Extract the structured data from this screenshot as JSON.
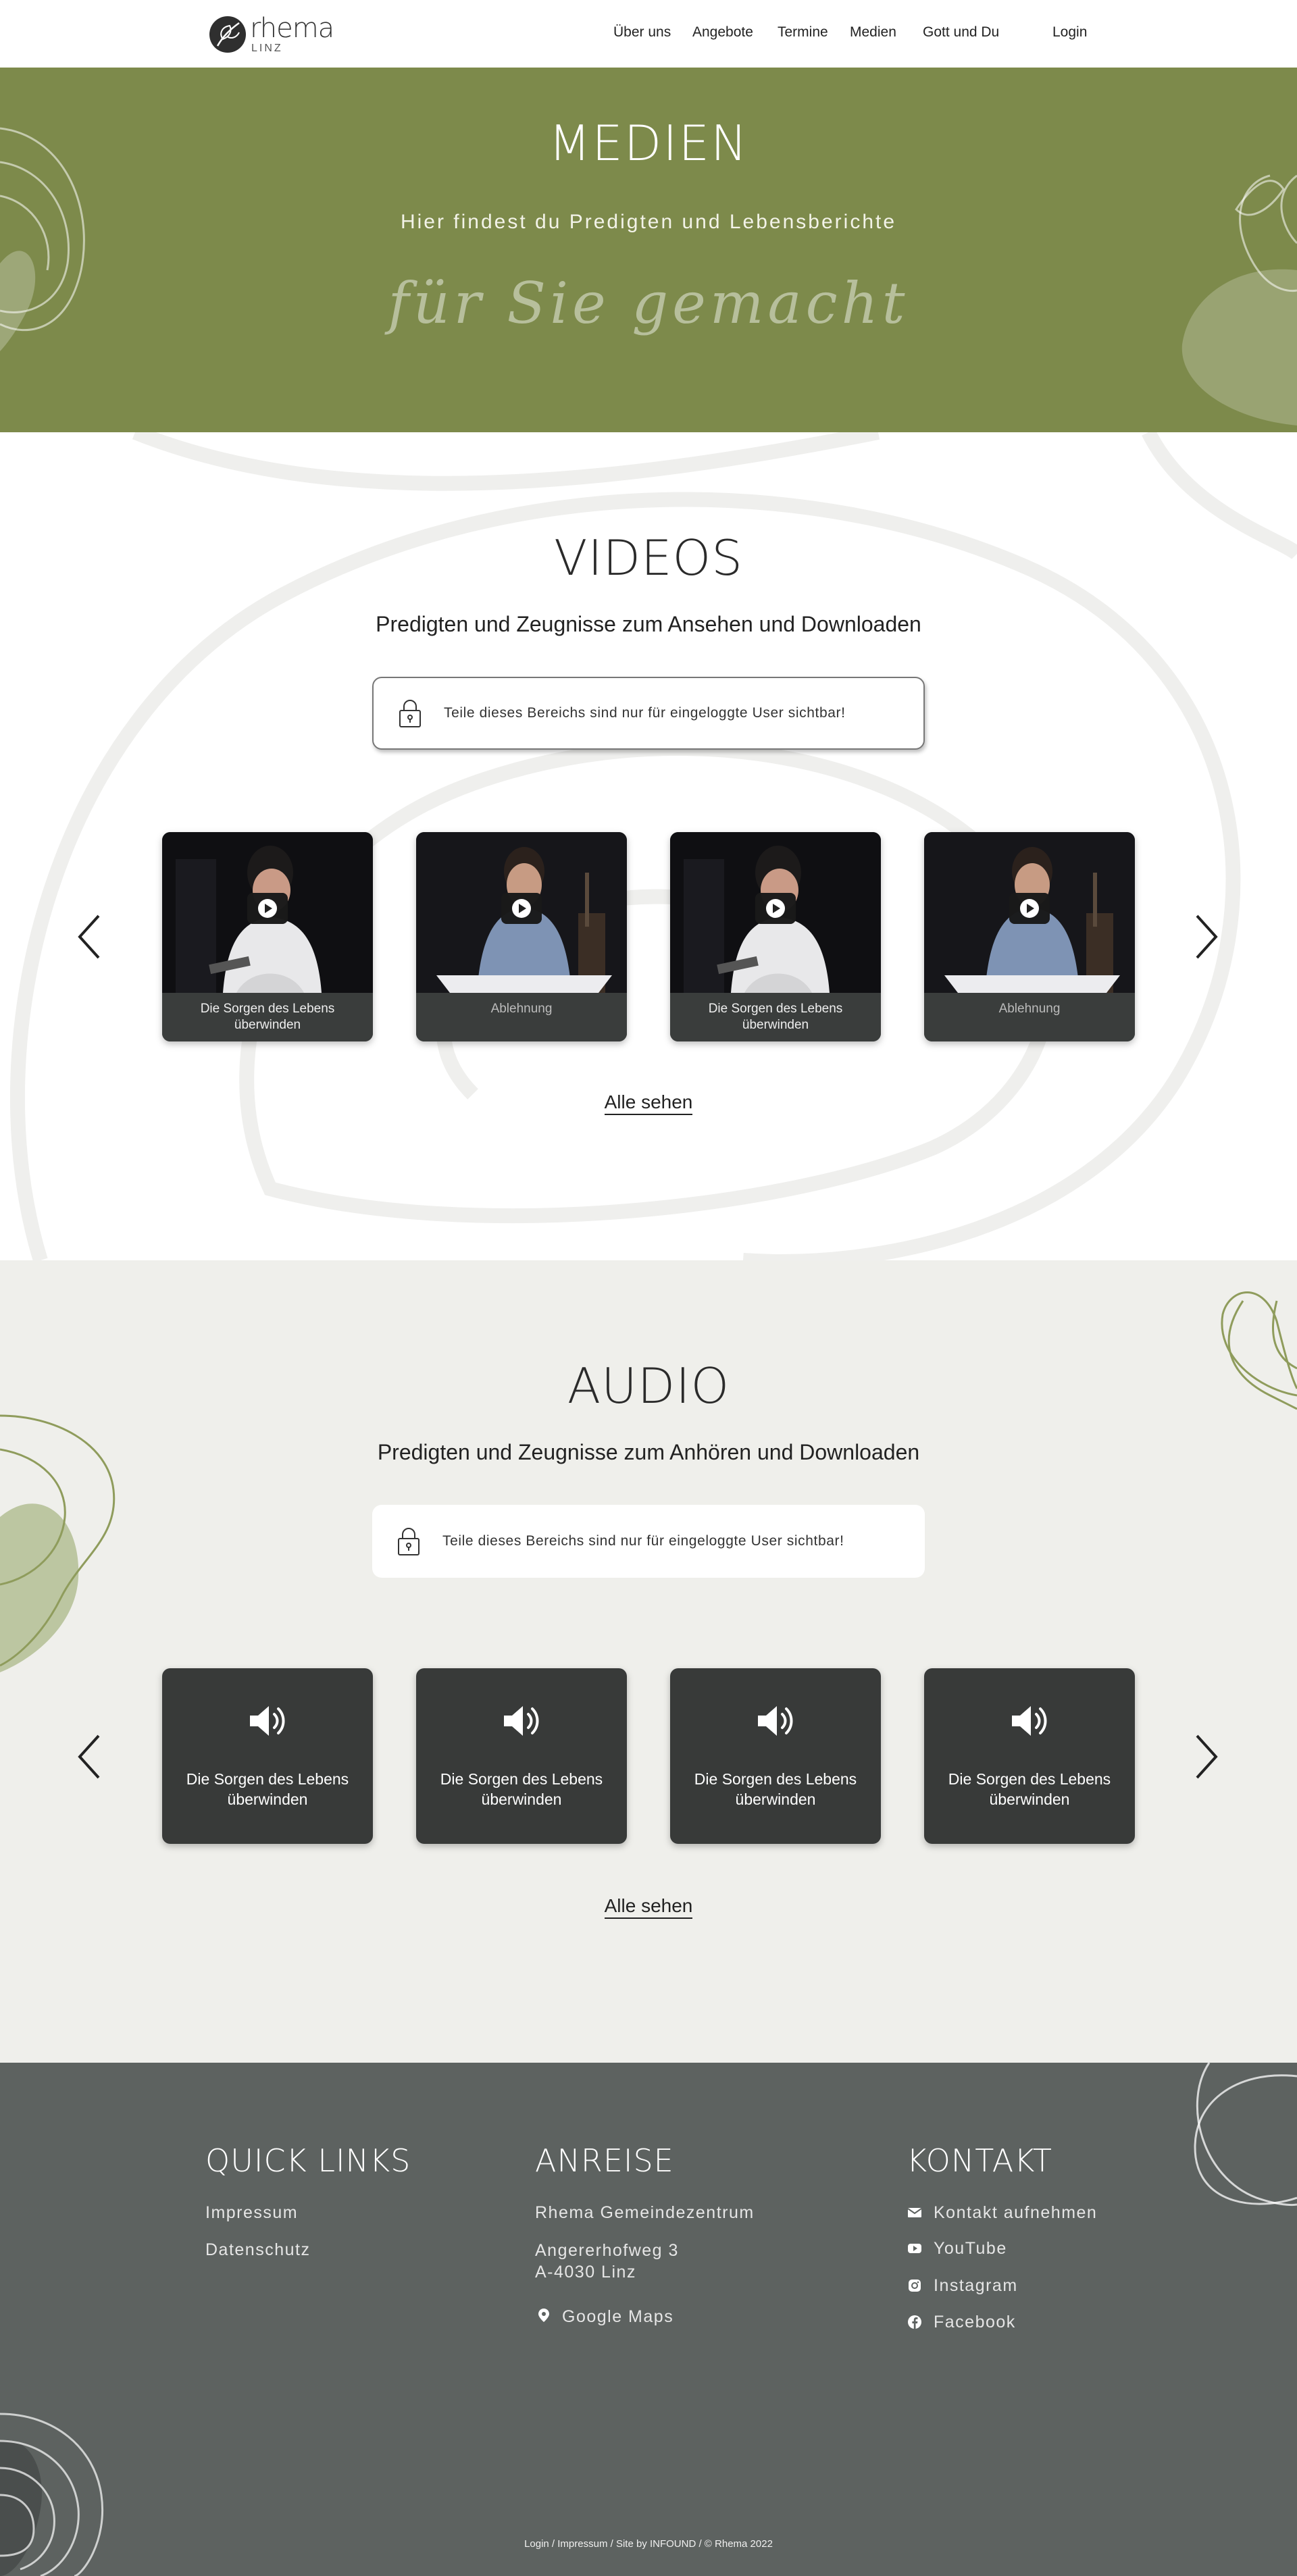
{
  "header": {
    "logo_name": "rhema",
    "logo_sub": "LINZ",
    "nav": [
      {
        "label": "Über uns"
      },
      {
        "label": "Angebote"
      },
      {
        "label": "Termine"
      },
      {
        "label": "Medien"
      },
      {
        "label": "Gott und Du"
      },
      {
        "label": "Login"
      }
    ]
  },
  "hero": {
    "title": "MEDIEN",
    "subtitle": "Hier findest du Predigten und Lebensberichte",
    "script": "für Sie gemacht",
    "background": "#7d8a4b"
  },
  "videos": {
    "title": "VIDEOS",
    "subtitle": "Predigten und Zeugnisse zum Ansehen und Downloaden",
    "notice": "Teile dieses Bereichs sind nur für eingeloggte User sichtbar!",
    "items": [
      {
        "title": "Die Sorgen des Lebens überwinden"
      },
      {
        "title": "Ablehnung"
      },
      {
        "title": "Die Sorgen des Lebens überwinden"
      },
      {
        "title": "Ablehnung"
      }
    ],
    "see_all": "Alle sehen"
  },
  "audio": {
    "title": "AUDIO",
    "subtitle": "Predigten und Zeugnisse zum Anhören und Downloaden",
    "notice": "Teile dieses Bereichs sind nur für eingeloggte User sichtbar!",
    "items": [
      {
        "title": "Die Sorgen des Lebens überwinden"
      },
      {
        "title": "Die Sorgen des Lebens überwinden"
      },
      {
        "title": "Die Sorgen des Lebens überwinden"
      },
      {
        "title": "Die Sorgen des Lebens überwinden"
      }
    ],
    "see_all": "Alle sehen",
    "background": "#efefeb"
  },
  "footer": {
    "quick_links": {
      "title": "QUICK LINKS",
      "links": [
        "Impressum",
        "Datenschutz"
      ]
    },
    "anreise": {
      "title": "ANREISE",
      "venue": "Rhema Gemeindezentrum",
      "street": "Angererhofweg 3",
      "city": "A-4030 Linz",
      "maps": "Google Maps"
    },
    "kontakt": {
      "title": "KONTAKT",
      "links": [
        {
          "label": "Kontakt aufnehmen",
          "icon": "mail-icon"
        },
        {
          "label": "YouTube",
          "icon": "youtube-icon"
        },
        {
          "label": "Instagram",
          "icon": "instagram-icon"
        },
        {
          "label": "Facebook",
          "icon": "facebook-icon"
        }
      ]
    },
    "bottom": "Login / Impressum / Site by INFOUND / © Rhema 2022",
    "background": "#5d6260"
  }
}
